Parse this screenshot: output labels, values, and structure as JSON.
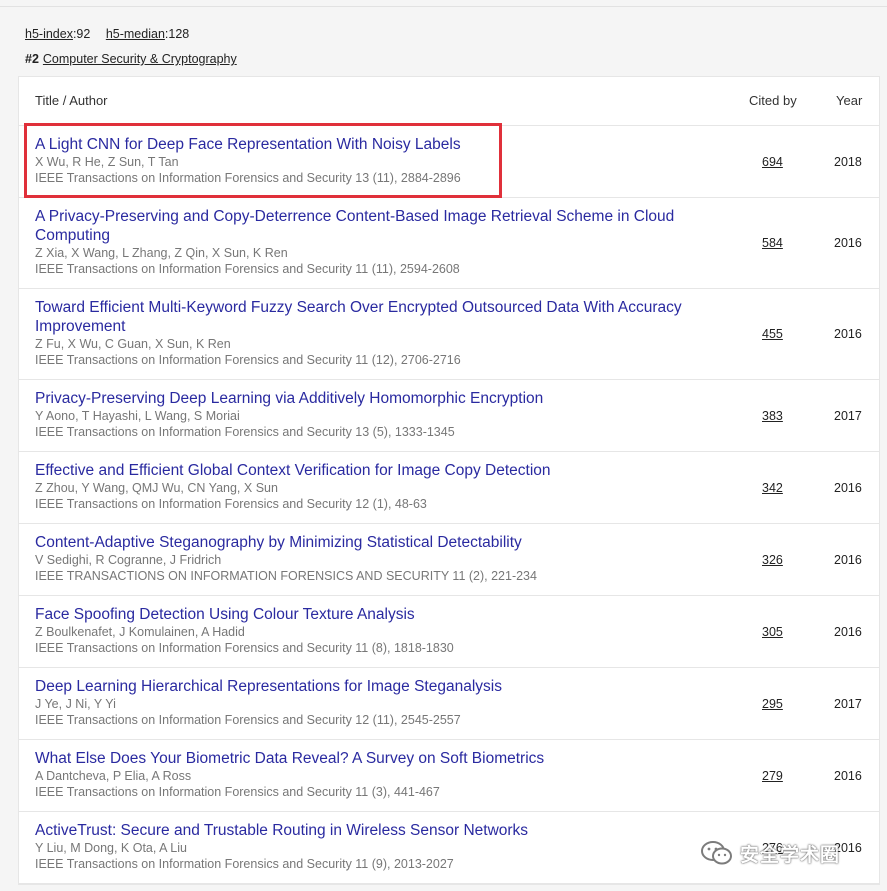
{
  "metrics": {
    "h5_index_label": "h5-index",
    "h5_index_value": ":92",
    "h5_median_label": "h5-median",
    "h5_median_value": ":128"
  },
  "category": {
    "rank": "#2",
    "name": "Computer Security & Cryptography"
  },
  "table": {
    "headers": {
      "title": "Title / Author",
      "cited": "Cited by",
      "year": "Year"
    },
    "rows": [
      {
        "title": "A Light CNN for Deep Face Representation With Noisy Labels",
        "authors": "X Wu, R He, Z Sun, T Tan",
        "venue": "IEEE Transactions on Information Forensics and Security 13 (11), 2884-2896",
        "cited": "694",
        "year": "2018"
      },
      {
        "title": "A Privacy-Preserving and Copy-Deterrence Content-Based Image Retrieval Scheme in Cloud Computing",
        "authors": "Z Xia, X Wang, L Zhang, Z Qin, X Sun, K Ren",
        "venue": "IEEE Transactions on Information Forensics and Security 11 (11), 2594-2608",
        "cited": "584",
        "year": "2016"
      },
      {
        "title": "Toward Efficient Multi-Keyword Fuzzy Search Over Encrypted Outsourced Data With Accuracy Improvement",
        "authors": "Z Fu, X Wu, C Guan, X Sun, K Ren",
        "venue": "IEEE Transactions on Information Forensics and Security 11 (12), 2706-2716",
        "cited": "455",
        "year": "2016"
      },
      {
        "title": "Privacy-Preserving Deep Learning via Additively Homomorphic Encryption",
        "authors": "Y Aono, T Hayashi, L Wang, S Moriai",
        "venue": "IEEE Transactions on Information Forensics and Security 13 (5), 1333-1345",
        "cited": "383",
        "year": "2017"
      },
      {
        "title": "Effective and Efficient Global Context Verification for Image Copy Detection",
        "authors": "Z Zhou, Y Wang, QMJ Wu, CN Yang, X Sun",
        "venue": "IEEE Transactions on Information Forensics and Security 12 (1), 48-63",
        "cited": "342",
        "year": "2016"
      },
      {
        "title": "Content-Adaptive Steganography by Minimizing Statistical Detectability",
        "authors": "V Sedighi, R Cogranne, J Fridrich",
        "venue": "IEEE TRANSACTIONS ON INFORMATION FORENSICS AND SECURITY 11 (2), 221-234",
        "cited": "326",
        "year": "2016"
      },
      {
        "title": "Face Spoofing Detection Using Colour Texture Analysis",
        "authors": "Z Boulkenafet, J Komulainen, A Hadid",
        "venue": "IEEE Transactions on Information Forensics and Security 11 (8), 1818-1830",
        "cited": "305",
        "year": "2016"
      },
      {
        "title": "Deep Learning Hierarchical Representations for Image Steganalysis",
        "authors": "J Ye, J Ni, Y Yi",
        "venue": "IEEE Transactions on Information Forensics and Security 12 (11), 2545-2557",
        "cited": "295",
        "year": "2017"
      },
      {
        "title": "What Else Does Your Biometric Data Reveal? A Survey on Soft Biometrics",
        "authors": "A Dantcheva, P Elia, A Ross",
        "venue": "IEEE Transactions on Information Forensics and Security 11 (3), 441-467",
        "cited": "279",
        "year": "2016"
      },
      {
        "title": "ActiveTrust: Secure and Trustable Routing in Wireless Sensor Networks",
        "authors": "Y Liu, M Dong, K Ota, A Liu",
        "venue": "IEEE Transactions on Information Forensics and Security 11 (9), 2013-2027",
        "cited": "276",
        "year": "2016"
      }
    ]
  },
  "watermark": {
    "text": "安全学术圈"
  },
  "colors": {
    "title_link": "#2a2aa0",
    "highlight_box": "#e0303a",
    "meta_text": "#777777"
  }
}
